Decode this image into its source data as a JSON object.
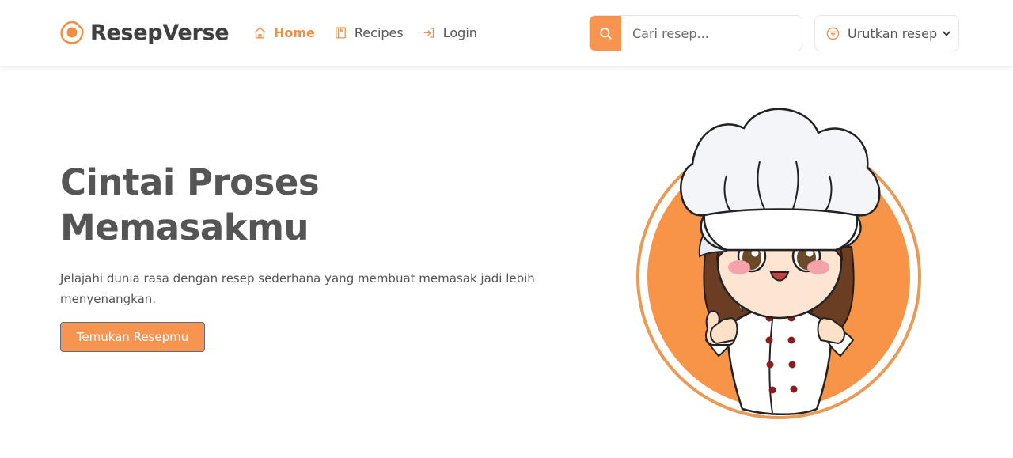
{
  "brand": {
    "name": "ResepVerse",
    "logo_icon": "fried-egg-icon",
    "accent": "#f79550"
  },
  "nav": {
    "items": [
      {
        "label": "Home",
        "icon": "home-icon",
        "active": true
      },
      {
        "label": "Recipes",
        "icon": "book-icon",
        "active": false
      },
      {
        "label": "Login",
        "icon": "login-icon",
        "active": false
      }
    ]
  },
  "search": {
    "placeholder": "Cari resep...",
    "value": "",
    "icon": "search-icon"
  },
  "sort": {
    "label": "Urutkan resep",
    "icon": "filter-icon"
  },
  "hero": {
    "title_line1": "Cintai Proses",
    "title_line2": "Memasakmu",
    "subtitle": "Jelajahi dunia rasa dengan resep sederhana yang membuat memasak jadi lebih menyenangkan.",
    "cta_label": "Temukan Resepmu",
    "image": "chef-girl-illustration"
  }
}
